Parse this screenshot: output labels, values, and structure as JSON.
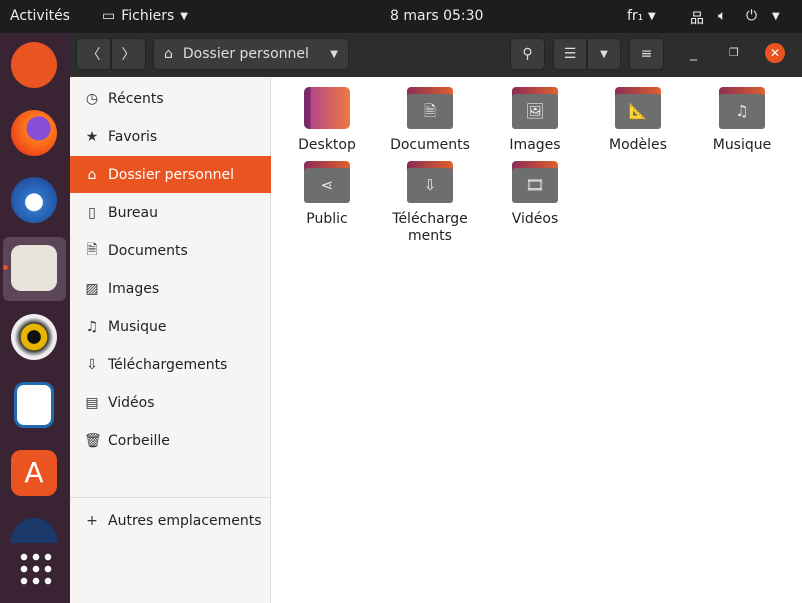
{
  "topbar": {
    "activities": "Activités",
    "app": "Fichiers",
    "datetime": "8 mars  05:30",
    "keyboard": "fr₁"
  },
  "dock": {
    "items": [
      "Ubuntu",
      "Firefox",
      "Thunderbird",
      "Fichiers",
      "Rhythmbox",
      "LibreOffice Writer",
      "Ubuntu Software",
      "Disque",
      "Applications"
    ]
  },
  "header": {
    "location": "Dossier personnel"
  },
  "sidebar": {
    "items": [
      {
        "label": "Récents",
        "icon": "clock"
      },
      {
        "label": "Favoris",
        "icon": "star"
      },
      {
        "label": "Dossier personnel",
        "icon": "home"
      },
      {
        "label": "Bureau",
        "icon": "desktop"
      },
      {
        "label": "Documents",
        "icon": "document"
      },
      {
        "label": "Images",
        "icon": "image"
      },
      {
        "label": "Musique",
        "icon": "music"
      },
      {
        "label": "Téléchargements",
        "icon": "download"
      },
      {
        "label": "Vidéos",
        "icon": "film"
      },
      {
        "label": "Corbeille",
        "icon": "trash"
      }
    ],
    "other": "Autres emplacements"
  },
  "files": [
    {
      "label": "Desktop"
    },
    {
      "label": "Documents",
      "glyph": "🗎"
    },
    {
      "label": "Images",
      "glyph": "🖼"
    },
    {
      "label": "Modèles",
      "glyph": "📐"
    },
    {
      "label": "Musique",
      "glyph": "♫"
    },
    {
      "label": "Public",
      "glyph": "⋖"
    },
    {
      "label": "Télécharge\nments",
      "glyph": "⇩"
    },
    {
      "label": "Vidéos",
      "glyph": "🎞"
    }
  ],
  "colors": {
    "accent": "#e95420"
  }
}
